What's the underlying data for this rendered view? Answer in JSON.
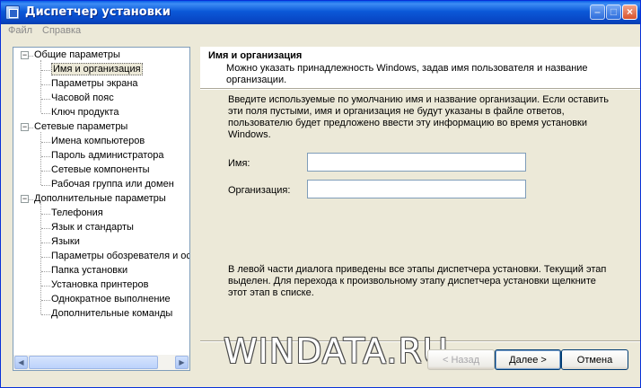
{
  "window": {
    "title": "Диспетчер установки"
  },
  "titlebar_buttons": {
    "minimize": "–",
    "maximize": "□",
    "close": "×"
  },
  "menu": [
    "Файл",
    "Справка"
  ],
  "tree": {
    "groups": [
      {
        "label": "Общие параметры",
        "expander": "−",
        "items": [
          "Имя и организация",
          "Параметры экрана",
          "Часовой пояс",
          "Ключ продукта"
        ]
      },
      {
        "label": "Сетевые параметры",
        "expander": "−",
        "items": [
          "Имена компьютеров",
          "Пароль администратора",
          "Сетевые компоненты",
          "Рабочая группа или домен"
        ]
      },
      {
        "label": "Дополнительные параметры",
        "expander": "−",
        "items": [
          "Телефония",
          "Язык и стандарты",
          "Языки",
          "Параметры обозревателя и ос",
          "Папка установки",
          "Установка принтеров",
          "Однократное выполнение",
          "Дополнительные команды"
        ]
      }
    ],
    "scroll_left": "◀",
    "scroll_right": "▶"
  },
  "header": {
    "title": "Имя и организация",
    "description": "Можно указать принадлежность Windows, задав имя пользователя и название организации."
  },
  "intro": "Введите используемые по умолчанию имя и название организации. Если оставить эти поля пустыми, имя и организация не будут указаны в файле ответов, пользователю будет предложено ввести эту информацию во время установки Windows.",
  "fields": {
    "name_label": "Имя:",
    "name_value": "",
    "org_label": "Организация:",
    "org_value": ""
  },
  "hint": "В левой части диалога приведены все этапы диспетчера установки. Текущий этап выделен. Для перехода к произвольному этапу диспетчера установки щелкните этот этап в списке.",
  "watermark": "WINDATA.RU",
  "buttons": {
    "back": "< Назад",
    "next": "Далее >",
    "cancel": "Отмена"
  }
}
